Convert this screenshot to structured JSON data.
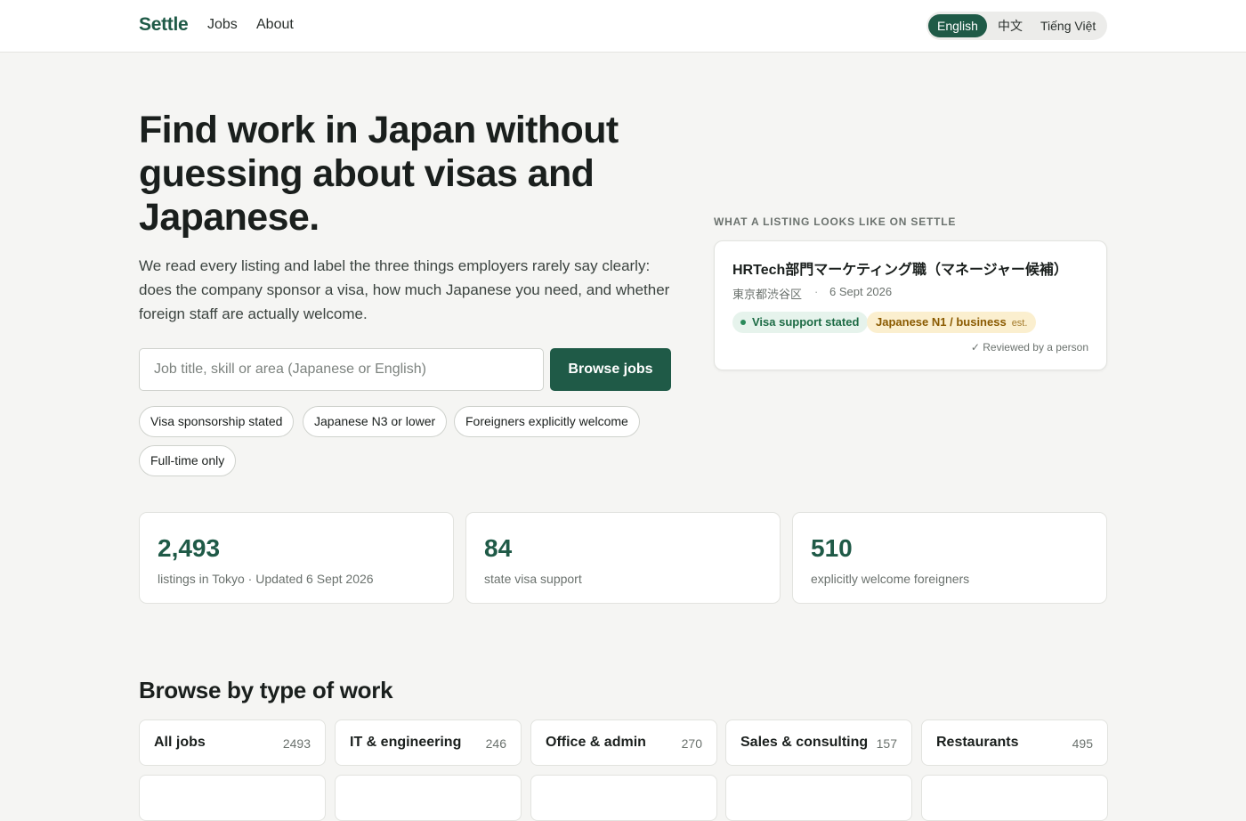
{
  "header": {
    "brand": "Settle",
    "nav": [
      "Jobs",
      "About"
    ],
    "languages": [
      {
        "label": "English",
        "active": true
      },
      {
        "label": "中文",
        "active": false
      },
      {
        "label": "Tiếng Việt",
        "active": false
      }
    ]
  },
  "hero": {
    "title": "Find work in Japan without guessing about visas and Japanese.",
    "subtitle": "We read every listing and label the three things employers rarely say clearly: does the company sponsor a visa, how much Japanese you need, and whether foreign staff are actually welcome.",
    "search_placeholder": "Job title, skill or area (Japanese or English)",
    "search_value": "",
    "browse_label": "Browse jobs",
    "filters": [
      "Visa sponsorship stated",
      "Japanese N3 or lower",
      "Foreigners explicitly welcome",
      "Full-time only"
    ]
  },
  "preview": {
    "label": "WHAT A LISTING LOOKS LIKE ON SETTLE",
    "title": "HRTech部門マーケティング職（マネージャー候補）",
    "location": "東京都渋谷区",
    "separator": "·",
    "date": "6 Sept 2026",
    "badge_visa": "Visa support stated",
    "badge_japanese": "Japanese N1 / business",
    "badge_japanese_note": "est.",
    "reviewed": "✓ Reviewed by a person"
  },
  "stats": [
    {
      "value": "2,493",
      "label": "listings in Tokyo · Updated 6 Sept 2026"
    },
    {
      "value": "84",
      "label": "state visa support"
    },
    {
      "value": "510",
      "label": "explicitly welcome foreigners"
    }
  ],
  "categories": {
    "title": "Browse by type of work",
    "items": [
      {
        "name": "All jobs",
        "count": "2493"
      },
      {
        "name": "IT & engineering",
        "count": "246"
      },
      {
        "name": "Office & admin",
        "count": "270"
      },
      {
        "name": "Sales & consulting",
        "count": "157"
      },
      {
        "name": "Restaurants",
        "count": "495"
      }
    ]
  },
  "colors": {
    "brand": "#1f5a47",
    "background": "#f5f5f3",
    "visa_badge_bg": "#e6f3ec",
    "japanese_badge_bg": "#fbefcf"
  }
}
